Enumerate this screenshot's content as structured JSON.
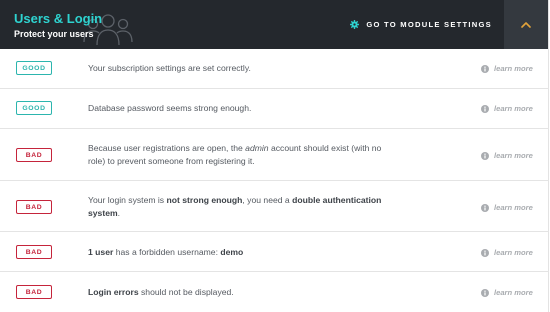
{
  "header": {
    "title": "Users & Login",
    "subtitle": "Protect your users",
    "module_settings_label": "GO TO MODULE SETTINGS",
    "icon": "users-icon",
    "accent_color": "#2ed3d0",
    "background_color": "#24282d"
  },
  "status_colors": {
    "good": "#2cb5ae",
    "bad": "#c5243b"
  },
  "rows": [
    {
      "status": "GOOD",
      "message_parts": [
        "Your subscription settings are set correctly."
      ],
      "link": "learn more"
    },
    {
      "status": "GOOD",
      "message_parts": [
        "Database password seems strong enough."
      ],
      "link": "learn more"
    },
    {
      "status": "BAD",
      "message_parts": [
        "Because user registrations are open, the ",
        "admin",
        " account should exist (with no role) to prevent someone from registering it."
      ],
      "link": "learn more"
    },
    {
      "status": "BAD",
      "message_parts": [
        "Your login system is ",
        "not strong enough",
        ", you need a ",
        "double authentication system",
        "."
      ],
      "link": "learn more"
    },
    {
      "status": "BAD",
      "message_parts": [
        "1 user",
        " has a forbidden username: ",
        "demo"
      ],
      "link": "learn more"
    },
    {
      "status": "BAD",
      "message_parts": [
        "Login errors",
        " should not be displayed."
      ],
      "link": "learn more"
    }
  ]
}
